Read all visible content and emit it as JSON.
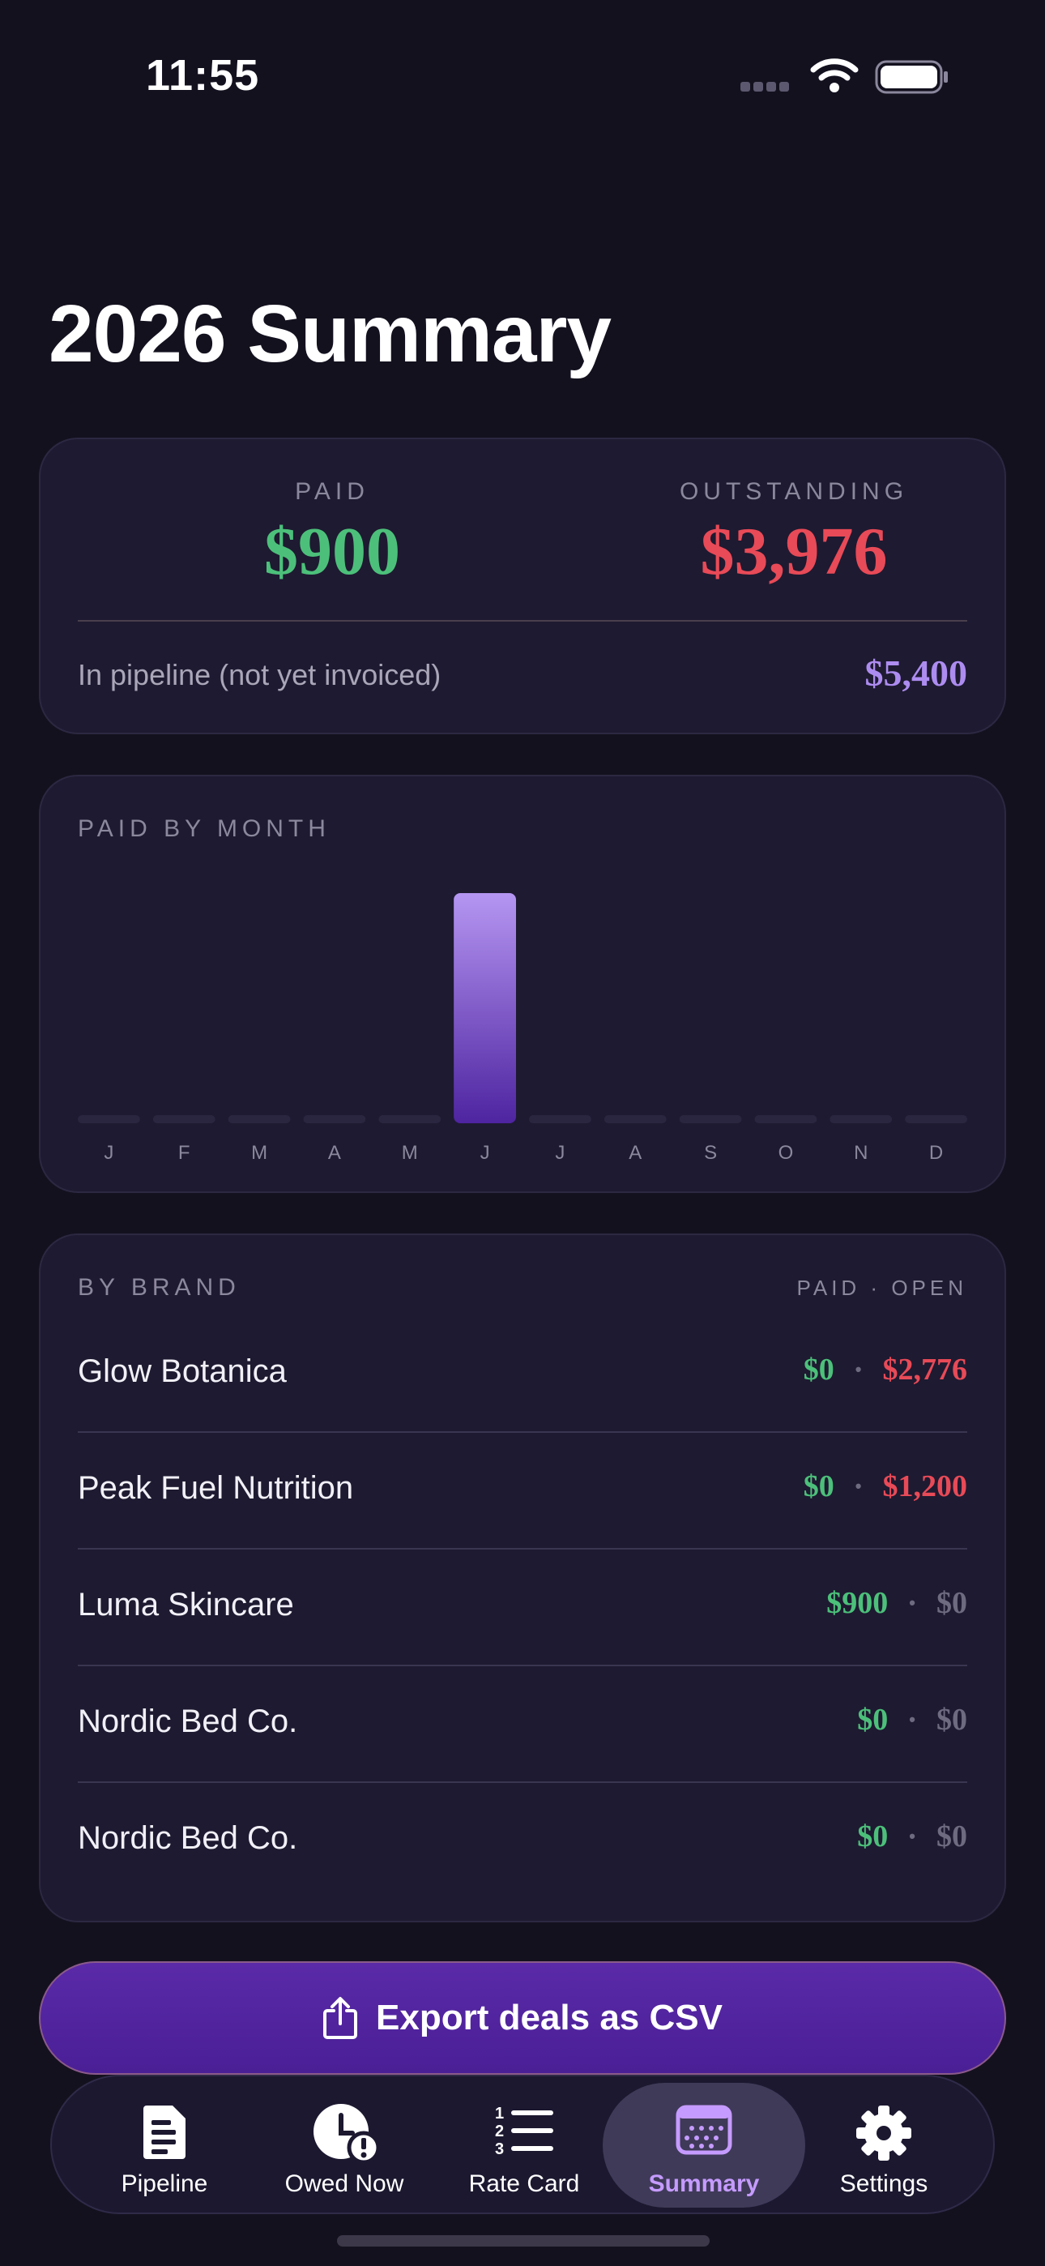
{
  "status_bar": {
    "time": "11:55"
  },
  "page": {
    "title": "2026 Summary"
  },
  "totals": {
    "paid_label": "PAID",
    "paid_amount": "$900",
    "outstanding_label": "OUTSTANDING",
    "outstanding_amount": "$3,976",
    "pipeline_label": "In pipeline (not yet invoiced)",
    "pipeline_amount": "$5,400"
  },
  "chart_data": {
    "type": "bar",
    "title": "PAID BY MONTH",
    "categories": [
      "J",
      "F",
      "M",
      "A",
      "M",
      "J",
      "J",
      "A",
      "S",
      "O",
      "N",
      "D"
    ],
    "values": [
      0,
      0,
      0,
      0,
      0,
      900,
      0,
      0,
      0,
      0,
      0,
      0
    ],
    "ylim": [
      0,
      900
    ],
    "grid": false,
    "colors": {
      "bar_top": "#b596f2",
      "bar_bottom": "#4e24a0",
      "empty": "#2a2640",
      "tick": "#8b879c"
    }
  },
  "by_brand": {
    "title": "BY BRAND",
    "columns_label": "PAID · OPEN",
    "rows": [
      {
        "name": "Glow Botanica",
        "paid": "$0",
        "open": "$2,776",
        "open_status": "red"
      },
      {
        "name": "Peak Fuel Nutrition",
        "paid": "$0",
        "open": "$1,200",
        "open_status": "red"
      },
      {
        "name": "Luma Skincare",
        "paid": "$900",
        "open": "$0",
        "open_status": "muted"
      },
      {
        "name": "Nordic Bed Co.",
        "paid": "$0",
        "open": "$0",
        "open_status": "muted"
      },
      {
        "name": "Nordic Bed Co.",
        "paid": "$0",
        "open": "$0",
        "open_status": "muted"
      }
    ]
  },
  "export": {
    "label": "Export deals as CSV",
    "icon": "share-icon"
  },
  "tabs": [
    {
      "label": "Pipeline",
      "icon": "document-icon",
      "active": false
    },
    {
      "label": "Owed Now",
      "icon": "clock-alert-icon",
      "active": false
    },
    {
      "label": "Rate Card",
      "icon": "numbered-list-icon",
      "active": false
    },
    {
      "label": "Summary",
      "icon": "calendar-icon",
      "active": true
    },
    {
      "label": "Settings",
      "icon": "gear-icon",
      "active": false
    }
  ],
  "colors": {
    "background": "#14111f",
    "card": "#1e1a31",
    "paid_green": "#4cc07a",
    "outstanding_red": "#e84a57",
    "pipeline_purple": "#ad8cf0",
    "accent": "#c59bff"
  }
}
